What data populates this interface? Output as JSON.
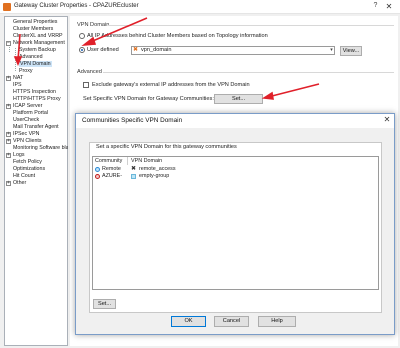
{
  "window": {
    "title": "Gateway Cluster Properties - CPAZUREcluster",
    "help": "?",
    "close": "✕"
  },
  "tree": {
    "items": [
      {
        "label": "General Properties"
      },
      {
        "label": "Cluster Members"
      },
      {
        "label": "ClusterXL and VRRP"
      },
      {
        "label": "Network Management",
        "expander": "−"
      },
      {
        "label": "System Backup"
      },
      {
        "label": "Advanced"
      },
      {
        "label": "VPN Domain"
      },
      {
        "label": "Proxy"
      },
      {
        "label": "NAT",
        "expander": "+"
      },
      {
        "label": "IPS"
      },
      {
        "label": "HTTPS Inspection"
      },
      {
        "label": "HTTP/HTTPS Proxy"
      },
      {
        "label": "ICAP Server",
        "expander": "+"
      },
      {
        "label": "Platform Portal"
      },
      {
        "label": "UserCheck"
      },
      {
        "label": "Mail Transfer Agent"
      },
      {
        "label": "IPSec VPN",
        "expander": "+"
      },
      {
        "label": "VPN Clients",
        "expander": "+"
      },
      {
        "label": "Monitoring Software blad"
      },
      {
        "label": "Logs",
        "expander": "+"
      },
      {
        "label": "Fetch Policy"
      },
      {
        "label": "Optimizations"
      },
      {
        "label": "Hit Count"
      },
      {
        "label": "Other",
        "expander": "+"
      }
    ]
  },
  "vpn_domain": {
    "section_title": "VPN Domain",
    "option_all": "All IP Addresses behind Cluster Members based on Topology information",
    "option_user": "User defined",
    "domain_value": "vpn_domain",
    "view_button": "View..."
  },
  "advanced": {
    "section_title": "Advanced",
    "exclude_label": "Exclude gateway's external IP addresses from the VPN Domain",
    "set_specific_label": "Set Specific VPN Domain for Gateway Communities:",
    "set_button": "Set..."
  },
  "dialog": {
    "title": "Communities Specific VPN Domain",
    "close": "✕",
    "description": "Set a specific VPN Domain for this gateway communities",
    "columns": [
      "Community",
      "VPN Domain"
    ],
    "rows": [
      {
        "community": "Remote",
        "vpn_domain": "remote_access"
      },
      {
        "community": "AZURE-",
        "vpn_domain": "empty-group"
      }
    ],
    "set_button": "Set...",
    "ok": "OK",
    "cancel": "Cancel",
    "help": "Help"
  },
  "colors": {
    "arrow": "#e0202a",
    "selection": "#cde4f7",
    "brand": "#e07020"
  }
}
